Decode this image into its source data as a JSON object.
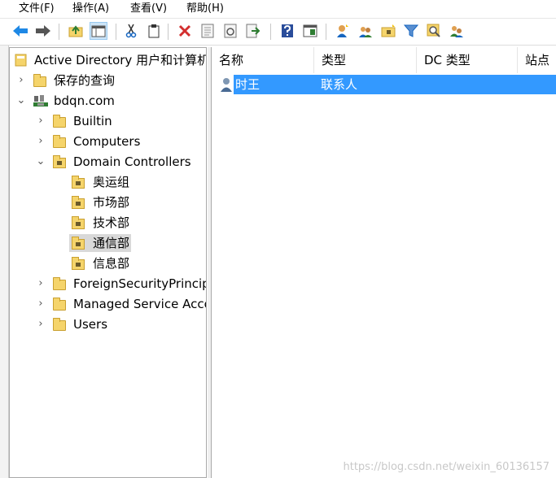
{
  "menu": [
    "文件(F)",
    "操作(A)",
    "查看(V)",
    "帮助(H)"
  ],
  "toolbar": {
    "icons": [
      "back-arrow-icon",
      "forward-arrow-icon",
      "up-folder-icon",
      "console-tree-icon",
      "cut-icon",
      "paste-icon",
      "delete-icon",
      "properties-icon",
      "refresh-icon",
      "export-list-icon",
      "help-icon",
      "show-hide-pane-icon",
      "new-user-icon",
      "new-group-icon",
      "new-ou-icon",
      "filter-icon",
      "find-icon",
      "add-to-group-icon"
    ],
    "active": "console-tree-icon"
  },
  "tree": {
    "root": "Active Directory 用户和计算机",
    "items": [
      {
        "label": "保存的查询",
        "chevron": "›"
      },
      {
        "label": "bdqn.com",
        "chevron": "⌄"
      },
      {
        "label": "Builtin",
        "chevron": "›"
      },
      {
        "label": "Computers",
        "chevron": "›"
      },
      {
        "label": "Domain Controllers",
        "chevron": "⌄"
      },
      {
        "label": "奥运组"
      },
      {
        "label": "市场部"
      },
      {
        "label": "技术部"
      },
      {
        "label": "通信部",
        "selected": true
      },
      {
        "label": "信息部"
      },
      {
        "label": "ForeignSecurityPrincipa",
        "chevron": "›"
      },
      {
        "label": "Managed Service Acco",
        "chevron": "›"
      },
      {
        "label": "Users",
        "chevron": "›"
      }
    ]
  },
  "list": {
    "columns": [
      "名称",
      "类型",
      "DC 类型",
      "站点"
    ],
    "rows": [
      {
        "name": "时王",
        "type": "联系人",
        "icon": "contact-icon",
        "selected": true
      }
    ],
    "selection_color": "#3399ff"
  },
  "watermark": "https://blog.csdn.net/weixin_60136157"
}
